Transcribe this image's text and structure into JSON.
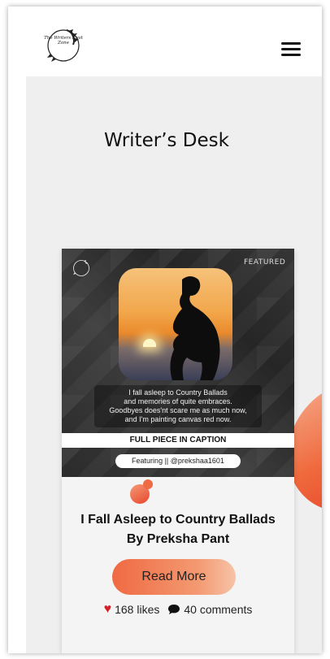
{
  "header": {
    "logo_text": "The Writers Nest Zone",
    "menu_icon": "hamburger-icon"
  },
  "page": {
    "title": "Writer’s Desk"
  },
  "card": {
    "logo_text": "The Writers Nest Zone",
    "featured_tag": "FEATURED",
    "poem_lines": [
      "I fall asleep to Country Ballads",
      "and memories of quite embraces.",
      "Goodbyes does'nt scare me as much now,",
      "and I'm painting canvas red now."
    ],
    "caption": "FULL PIECE IN CAPTION",
    "featuring": "Featuring || @prekshaa1601",
    "title_line1": "I Fall Asleep to Country Ballads",
    "title_line2": "By Preksha Pant",
    "read_more_label": "Read More",
    "likes": "168 likes",
    "comments": "40 comments"
  },
  "colors": {
    "accent": "#ef6a42",
    "heart": "#d81f26",
    "background": "#efefef"
  }
}
